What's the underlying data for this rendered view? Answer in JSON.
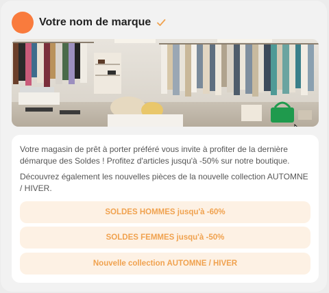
{
  "brand": {
    "name": "Votre nom de marque",
    "avatar_color": "#f97b3d",
    "verified_icon": "check-icon",
    "accent": "#f0a24f"
  },
  "message": {
    "paragraph_1": "Votre magasin de prêt à porter préféré vous invite à profiter de la dernière démarque des Soldes ! Profitez d'articles jusqu'à -50% sur notre boutique.",
    "paragraph_2": "Découvrez également les nouvelles pièces de la nouvelle collection AUTOMNE / HIVER."
  },
  "buttons": [
    {
      "label": "SOLDES HOMMES jusqu'à -60%"
    },
    {
      "label": "SOLDES FEMMES jusqu'à -50%"
    },
    {
      "label": "Nouvelle collection AUTOMNE / HIVER"
    }
  ]
}
